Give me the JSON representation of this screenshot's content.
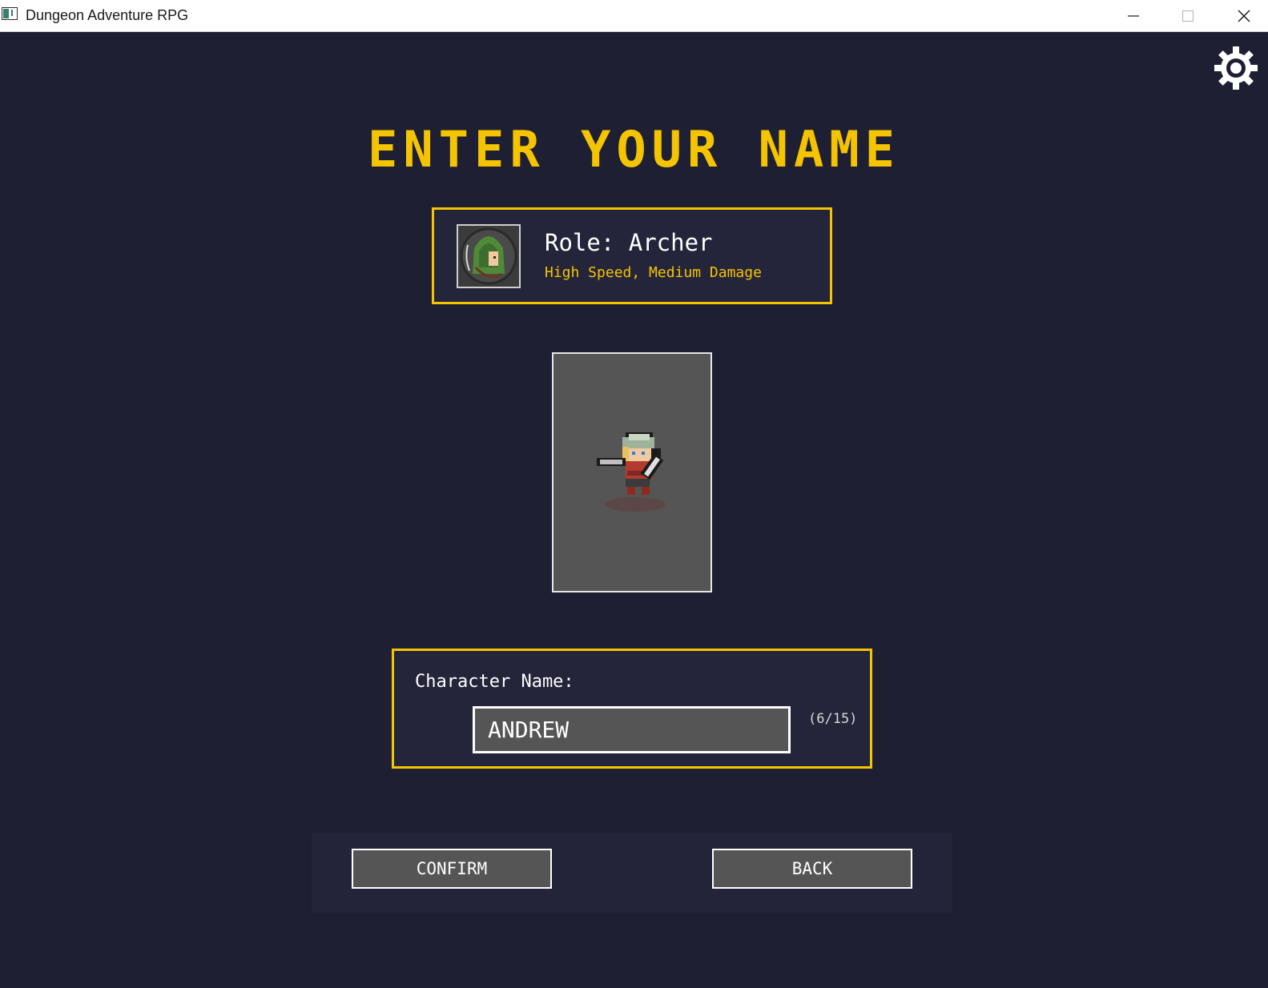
{
  "window": {
    "title": "Dungeon Adventure RPG",
    "controls": [
      "minimize-icon",
      "maximize-icon",
      "close-icon"
    ]
  },
  "settings": {
    "icon": "gear-icon"
  },
  "heading": "ENTER YOUR NAME",
  "role": {
    "title": "Role: Archer",
    "description": "High Speed, Medium Damage",
    "portrait_icon": "archer-portrait-icon"
  },
  "preview": {
    "sprite_icon": "archer-sprite-icon"
  },
  "name_entry": {
    "label": "Character Name:",
    "value": "ANDREW",
    "counter": "(6/15)"
  },
  "buttons": {
    "confirm": "CONFIRM",
    "back": "BACK"
  },
  "colors": {
    "background": "#1e1f33",
    "panel": "#24253a",
    "accent": "#f5c400",
    "control": "#555555",
    "text": "#ffffff"
  }
}
